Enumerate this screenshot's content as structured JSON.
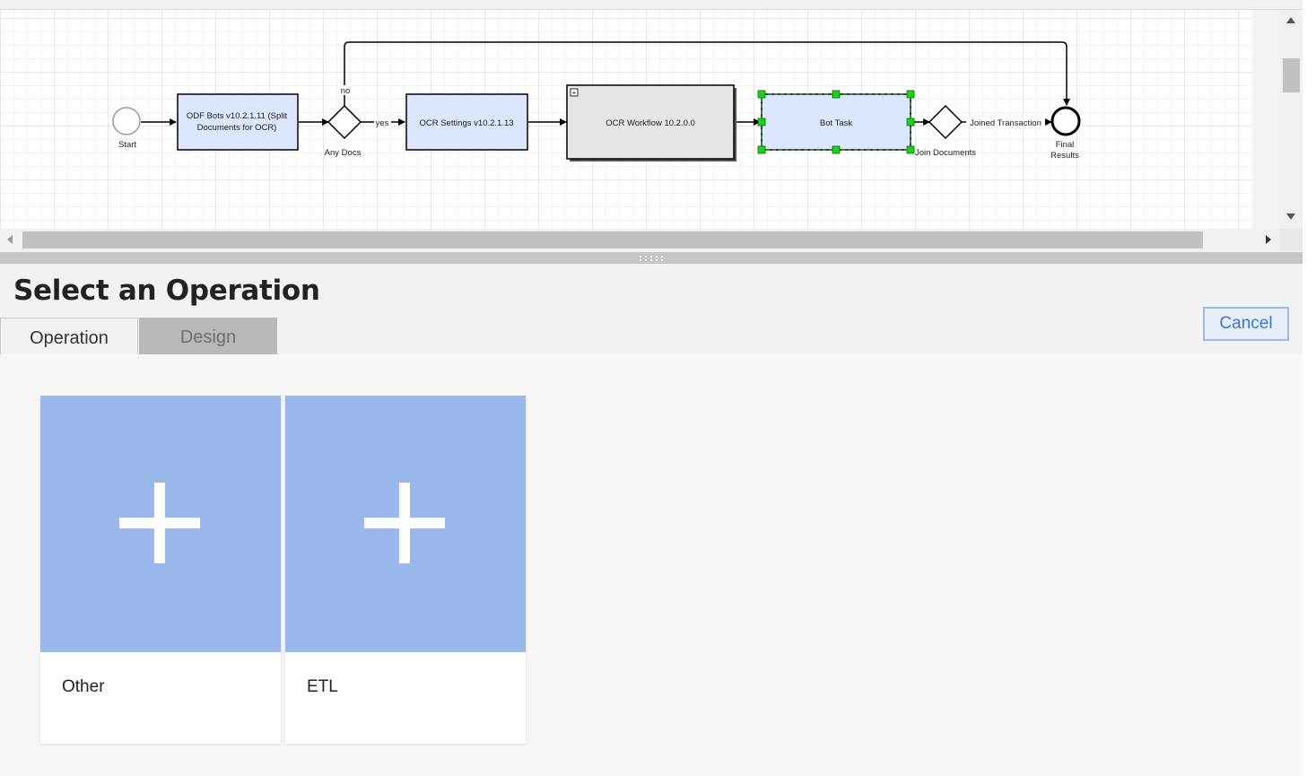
{
  "diagram": {
    "start_label": "Start",
    "task1_line1": "ODF Bots v10.2.1.11 (Split",
    "task1_line2": "Documents for OCR)",
    "gateway1_label": "Any Docs",
    "gateway1_no": "no",
    "gateway1_yes": "yes",
    "task2_label": "OCR Settings v10.2.1.13",
    "subprocess_label": "OCR Workflow 10.2.0.0",
    "subprocess_marker": "+",
    "task3_label": "Bot Task",
    "gateway2_label": "Join Documents",
    "edge_joined_label": "Joined Transaction",
    "end_line1": "Final",
    "end_line2": "Results",
    "colors": {
      "task_fill": "#dce6ff",
      "selection_handle": "#1bd11b",
      "selection_border": "#188a18"
    }
  },
  "panel": {
    "title": "Select an Operation",
    "tabs": [
      "Operation",
      "Design"
    ],
    "active_tab": "Operation",
    "cancel_label": "Cancel"
  },
  "cards": [
    {
      "label": "Other",
      "icon": "plus-icon"
    },
    {
      "label": "ETL",
      "icon": "plus-icon"
    }
  ],
  "colors": {
    "card_tile": "#9ab8ec",
    "cancel_accent": "#3a78d0"
  }
}
